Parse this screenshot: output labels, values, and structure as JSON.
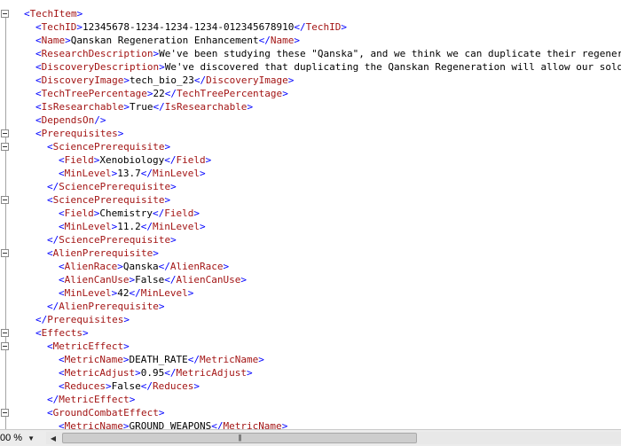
{
  "editor": {
    "lines": [
      {
        "indent": 0,
        "fold": true,
        "tokens": [
          [
            "br",
            "<"
          ],
          [
            "tag",
            "TechItem"
          ],
          [
            "br",
            ">"
          ]
        ]
      },
      {
        "indent": 1,
        "tokens": [
          [
            "br",
            "<"
          ],
          [
            "tag",
            "TechID"
          ],
          [
            "br",
            ">"
          ],
          [
            "txt",
            "12345678-1234-1234-1234-012345678910"
          ],
          [
            "br",
            "</"
          ],
          [
            "tag",
            "TechID"
          ],
          [
            "br",
            ">"
          ]
        ]
      },
      {
        "indent": 1,
        "tokens": [
          [
            "br",
            "<"
          ],
          [
            "tag",
            "Name"
          ],
          [
            "br",
            ">"
          ],
          [
            "txt",
            "Qanskan Regeneration Enhancement"
          ],
          [
            "br",
            "</"
          ],
          [
            "tag",
            "Name"
          ],
          [
            "br",
            ">"
          ]
        ]
      },
      {
        "indent": 1,
        "tokens": [
          [
            "br",
            "<"
          ],
          [
            "tag",
            "ResearchDescription"
          ],
          [
            "br",
            ">"
          ],
          [
            "txt",
            "We've been studying these \"Qanska\", and we think we can duplicate their regenerat"
          ]
        ]
      },
      {
        "indent": 1,
        "tokens": [
          [
            "br",
            "<"
          ],
          [
            "tag",
            "DiscoveryDescription"
          ],
          [
            "br",
            ">"
          ],
          [
            "txt",
            "We've discovered that duplicating the Qanskan Regeneration will allow our soldie"
          ]
        ]
      },
      {
        "indent": 1,
        "tokens": [
          [
            "br",
            "<"
          ],
          [
            "tag",
            "DiscoveryImage"
          ],
          [
            "br",
            ">"
          ],
          [
            "txt",
            "tech_bio_23"
          ],
          [
            "br",
            "</"
          ],
          [
            "tag",
            "DiscoveryImage"
          ],
          [
            "br",
            ">"
          ]
        ]
      },
      {
        "indent": 1,
        "tokens": [
          [
            "br",
            "<"
          ],
          [
            "tag",
            "TechTreePercentage"
          ],
          [
            "br",
            ">"
          ],
          [
            "txt",
            "22"
          ],
          [
            "br",
            "</"
          ],
          [
            "tag",
            "TechTreePercentage"
          ],
          [
            "br",
            ">"
          ]
        ]
      },
      {
        "indent": 1,
        "tokens": [
          [
            "br",
            "<"
          ],
          [
            "tag",
            "IsResearchable"
          ],
          [
            "br",
            ">"
          ],
          [
            "txt",
            "True"
          ],
          [
            "br",
            "</"
          ],
          [
            "tag",
            "IsResearchable"
          ],
          [
            "br",
            ">"
          ]
        ]
      },
      {
        "indent": 1,
        "tokens": [
          [
            "br",
            "<"
          ],
          [
            "tag",
            "DependsOn"
          ],
          [
            "br",
            "/>"
          ]
        ]
      },
      {
        "indent": 1,
        "fold": true,
        "tokens": [
          [
            "br",
            "<"
          ],
          [
            "tag",
            "Prerequisites"
          ],
          [
            "br",
            ">"
          ]
        ]
      },
      {
        "indent": 2,
        "fold": true,
        "tokens": [
          [
            "br",
            "<"
          ],
          [
            "tag",
            "SciencePrerequisite"
          ],
          [
            "br",
            ">"
          ]
        ]
      },
      {
        "indent": 3,
        "tokens": [
          [
            "br",
            "<"
          ],
          [
            "tag",
            "Field"
          ],
          [
            "br",
            ">"
          ],
          [
            "txt",
            "Xenobiology"
          ],
          [
            "br",
            "</"
          ],
          [
            "tag",
            "Field"
          ],
          [
            "br",
            ">"
          ]
        ]
      },
      {
        "indent": 3,
        "tokens": [
          [
            "br",
            "<"
          ],
          [
            "tag",
            "MinLevel"
          ],
          [
            "br",
            ">"
          ],
          [
            "txt",
            "13.7"
          ],
          [
            "br",
            "</"
          ],
          [
            "tag",
            "MinLevel"
          ],
          [
            "br",
            ">"
          ]
        ]
      },
      {
        "indent": 2,
        "tokens": [
          [
            "br",
            "</"
          ],
          [
            "tag",
            "SciencePrerequisite"
          ],
          [
            "br",
            ">"
          ]
        ]
      },
      {
        "indent": 2,
        "fold": true,
        "tokens": [
          [
            "br",
            "<"
          ],
          [
            "tag",
            "SciencePrerequisite"
          ],
          [
            "br",
            ">"
          ]
        ]
      },
      {
        "indent": 3,
        "tokens": [
          [
            "br",
            "<"
          ],
          [
            "tag",
            "Field"
          ],
          [
            "br",
            ">"
          ],
          [
            "txt",
            "Chemistry"
          ],
          [
            "br",
            "</"
          ],
          [
            "tag",
            "Field"
          ],
          [
            "br",
            ">"
          ]
        ]
      },
      {
        "indent": 3,
        "tokens": [
          [
            "br",
            "<"
          ],
          [
            "tag",
            "MinLevel"
          ],
          [
            "br",
            ">"
          ],
          [
            "txt",
            "11.2"
          ],
          [
            "br",
            "</"
          ],
          [
            "tag",
            "MinLevel"
          ],
          [
            "br",
            ">"
          ]
        ]
      },
      {
        "indent": 2,
        "tokens": [
          [
            "br",
            "</"
          ],
          [
            "tag",
            "SciencePrerequisite"
          ],
          [
            "br",
            ">"
          ]
        ]
      },
      {
        "indent": 2,
        "fold": true,
        "tokens": [
          [
            "br",
            "<"
          ],
          [
            "tag",
            "AlienPrerequisite"
          ],
          [
            "br",
            ">"
          ]
        ]
      },
      {
        "indent": 3,
        "tokens": [
          [
            "br",
            "<"
          ],
          [
            "tag",
            "AlienRace"
          ],
          [
            "br",
            ">"
          ],
          [
            "txt",
            "Qanska"
          ],
          [
            "br",
            "</"
          ],
          [
            "tag",
            "AlienRace"
          ],
          [
            "br",
            ">"
          ]
        ]
      },
      {
        "indent": 3,
        "tokens": [
          [
            "br",
            "<"
          ],
          [
            "tag",
            "AlienCanUse"
          ],
          [
            "br",
            ">"
          ],
          [
            "txt",
            "False"
          ],
          [
            "br",
            "</"
          ],
          [
            "tag",
            "AlienCanUse"
          ],
          [
            "br",
            ">"
          ]
        ]
      },
      {
        "indent": 3,
        "tokens": [
          [
            "br",
            "<"
          ],
          [
            "tag",
            "MinLevel"
          ],
          [
            "br",
            ">"
          ],
          [
            "txt",
            "42"
          ],
          [
            "br",
            "</"
          ],
          [
            "tag",
            "MinLevel"
          ],
          [
            "br",
            ">"
          ]
        ]
      },
      {
        "indent": 2,
        "tokens": [
          [
            "br",
            "</"
          ],
          [
            "tag",
            "AlienPrerequisite"
          ],
          [
            "br",
            ">"
          ]
        ]
      },
      {
        "indent": 1,
        "tokens": [
          [
            "br",
            "</"
          ],
          [
            "tag",
            "Prerequisites"
          ],
          [
            "br",
            ">"
          ]
        ]
      },
      {
        "indent": 1,
        "fold": true,
        "tokens": [
          [
            "br",
            "<"
          ],
          [
            "tag",
            "Effects"
          ],
          [
            "br",
            ">"
          ]
        ]
      },
      {
        "indent": 2,
        "fold": true,
        "tokens": [
          [
            "br",
            "<"
          ],
          [
            "tag",
            "MetricEffect"
          ],
          [
            "br",
            ">"
          ]
        ]
      },
      {
        "indent": 3,
        "tokens": [
          [
            "br",
            "<"
          ],
          [
            "tag",
            "MetricName"
          ],
          [
            "br",
            ">"
          ],
          [
            "txt",
            "DEATH_RATE"
          ],
          [
            "br",
            "</"
          ],
          [
            "tag",
            "MetricName"
          ],
          [
            "br",
            ">"
          ]
        ]
      },
      {
        "indent": 3,
        "tokens": [
          [
            "br",
            "<"
          ],
          [
            "tag",
            "MetricAdjust"
          ],
          [
            "br",
            ">"
          ],
          [
            "txt",
            "0.95"
          ],
          [
            "br",
            "</"
          ],
          [
            "tag",
            "MetricAdjust"
          ],
          [
            "br",
            ">"
          ]
        ]
      },
      {
        "indent": 3,
        "tokens": [
          [
            "br",
            "<"
          ],
          [
            "tag",
            "Reduces"
          ],
          [
            "br",
            ">"
          ],
          [
            "txt",
            "False"
          ],
          [
            "br",
            "</"
          ],
          [
            "tag",
            "Reduces"
          ],
          [
            "br",
            ">"
          ]
        ]
      },
      {
        "indent": 2,
        "tokens": [
          [
            "br",
            "</"
          ],
          [
            "tag",
            "MetricEffect"
          ],
          [
            "br",
            ">"
          ]
        ]
      },
      {
        "indent": 2,
        "fold": true,
        "tokens": [
          [
            "br",
            "<"
          ],
          [
            "tag",
            "GroundCombatEffect"
          ],
          [
            "br",
            ">"
          ]
        ]
      },
      {
        "indent": 3,
        "tokens": [
          [
            "br",
            "<"
          ],
          [
            "tag",
            "MetricName"
          ],
          [
            "br",
            ">"
          ],
          [
            "txt",
            "GROUND_WEAPONS"
          ],
          [
            "br",
            "</"
          ],
          [
            "tag",
            "MetricName"
          ],
          [
            "br",
            ">"
          ]
        ]
      }
    ]
  },
  "colors": {
    "bracket": "#0000ff",
    "tag": "#a31515",
    "text": "#000000"
  },
  "status": {
    "zoom_value": "00 %",
    "zoom_arrow_icon": "dropdown-arrow-icon",
    "scroll_left_icon": "arrow-left-icon",
    "thumb_grip": "|||"
  }
}
